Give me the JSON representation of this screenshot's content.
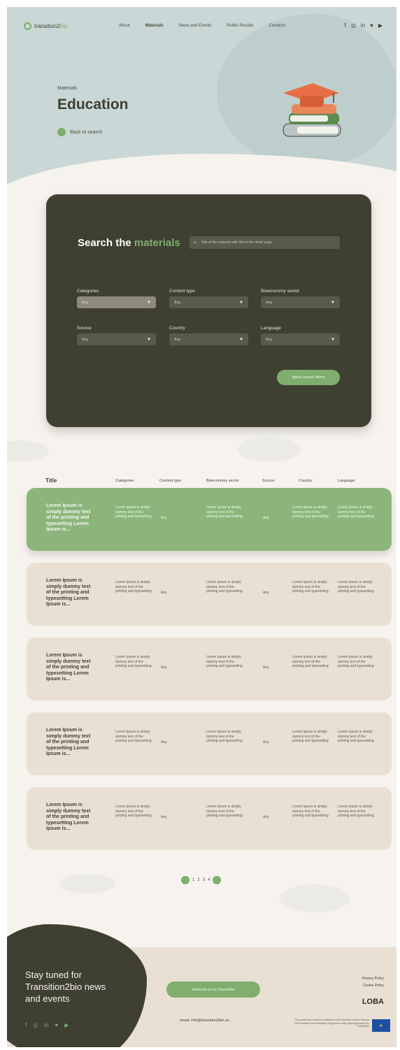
{
  "colors": {
    "accent": "#7fae6e",
    "dark": "#3f3f32",
    "beige": "#e9e0d3",
    "hero": "#c9d7d6"
  },
  "nav": {
    "logo_text": "transition2",
    "logo_accent": "bio",
    "links": [
      "About",
      "Materials",
      "News and Events",
      "Public Results",
      "Contacts"
    ],
    "active": "Materials",
    "social": [
      "f",
      "◎",
      "in",
      "♥",
      "▶"
    ]
  },
  "hero": {
    "breadcrumb": "Materials",
    "title": "Education",
    "back_label": "Back to search"
  },
  "search": {
    "title_prefix": "Search the",
    "title_accent": "materials",
    "placeholder": "Title of the material with link to the detail page",
    "filters": [
      {
        "label": "Categories",
        "value": "Any"
      },
      {
        "label": "Content type",
        "value": "Any"
      },
      {
        "label": "Bioeconomy sector",
        "value": "Any"
      },
      {
        "label": "Source",
        "value": "Any"
      },
      {
        "label": "Country",
        "value": "Any"
      },
      {
        "label": "Language",
        "value": "Any"
      }
    ],
    "apply_label": "Apply search filters"
  },
  "table": {
    "headers": [
      "Title",
      "Categories",
      "Content type",
      "Bioeconomy sector",
      "Source",
      "Country",
      "Language"
    ],
    "rows": [
      {
        "title": "Lorem Ipsum is simply dummy text of the printing and typesetting Lorem Ipsum is...",
        "categories": "Lorem Ipsum is simply dummy text of the printing and typesetting",
        "content_type": "Any",
        "sector": "Lorem Ipsum is simply dummy text of the printing and typesetting",
        "source": "Any",
        "country": "Lorem Ipsum is simply dummy text of the printing and typesetting",
        "language": "Lorem Ipsum is simply dummy text of the printing and typesetting"
      },
      {
        "title": "Lorem Ipsum is simply dummy text of the printing and typesetting Lorem Ipsum is...",
        "categories": "Lorem Ipsum is simply dummy text of the printing and typesetting",
        "content_type": "Any",
        "sector": "Lorem Ipsum is simply dummy text of the printing and typesetting",
        "source": "Any",
        "country": "Lorem Ipsum is simply dummy text of the printing and typesetting",
        "language": "Lorem Ipsum is simply dummy text of the printing and typesetting"
      },
      {
        "title": "Lorem Ipsum is simply dummy text of the printing and typesetting Lorem Ipsum is...",
        "categories": "Lorem Ipsum is simply dummy text of the printing and typesetting",
        "content_type": "Any",
        "sector": "Lorem Ipsum is simply dummy text of the printing and typesetting",
        "source": "Any",
        "country": "Lorem Ipsum is simply dummy text of the printing and typesetting",
        "language": "Lorem Ipsum is simply dummy text of the printing and typesetting"
      },
      {
        "title": "Lorem Ipsum is simply dummy text of the printing and typesetting Lorem Ipsum is...",
        "categories": "Lorem Ipsum is simply dummy text of the printing and typesetting",
        "content_type": "Any",
        "sector": "Lorem Ipsum is simply dummy text of the printing and typesetting",
        "source": "Any",
        "country": "Lorem Ipsum is simply dummy text of the printing and typesetting",
        "language": "Lorem Ipsum is simply dummy text of the printing and typesetting"
      },
      {
        "title": "Lorem Ipsum is simply dummy text of the printing and typesetting Lorem Ipsum is...",
        "categories": "Lorem Ipsum is simply dummy text of the printing and typesetting",
        "content_type": "Any",
        "sector": "Lorem Ipsum is simply dummy text of the printing and typesetting",
        "source": "Any",
        "country": "Lorem Ipsum is simply dummy text of the printing and typesetting",
        "language": "Lorem Ipsum is simply dummy text of the printing and typesetting"
      }
    ]
  },
  "pagination": {
    "pages": [
      "1",
      "2",
      "3",
      "4"
    ]
  },
  "footer": {
    "stay_tuned": "Stay tuned for Transition2bio news and events",
    "subscribe_label": "Subscribe to our Newsletter",
    "email": "email: info@transition2bio.eu",
    "privacy": "Privacy Policy",
    "cookie": "Cookie Policy",
    "brand": "LOBA",
    "eu_notice": "This project has received funding from the European Union's Horizon 2020 research and innovation programme under grant agreement No 101000556",
    "social": [
      "f",
      "◎",
      "in",
      "♥",
      "▶"
    ]
  }
}
